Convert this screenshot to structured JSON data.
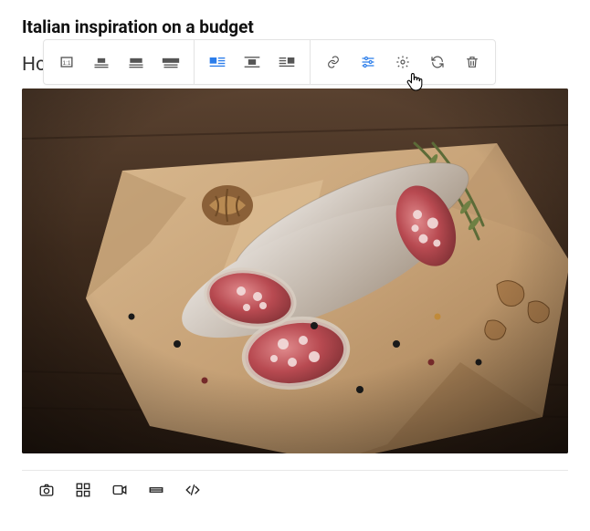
{
  "title": "Italian inspiration on a budget",
  "subtitle_partial": "Ho",
  "toolbar": {
    "groups": [
      {
        "items": [
          {
            "name": "size-original-icon",
            "active": false
          },
          {
            "name": "size-small-icon",
            "active": false
          },
          {
            "name": "size-medium-icon",
            "active": false
          },
          {
            "name": "size-wide-icon",
            "active": false
          }
        ]
      },
      {
        "items": [
          {
            "name": "align-left-icon",
            "active": true
          },
          {
            "name": "align-center-icon",
            "active": false
          },
          {
            "name": "align-right-icon",
            "active": false
          }
        ]
      },
      {
        "items": [
          {
            "name": "link-icon",
            "active": false
          },
          {
            "name": "edit-sliders-icon",
            "active": true
          },
          {
            "name": "settings-gear-icon",
            "active": false
          },
          {
            "name": "refresh-icon",
            "active": false
          },
          {
            "name": "trash-icon",
            "active": false
          }
        ]
      }
    ]
  },
  "bottom_bar": {
    "items": [
      {
        "name": "camera-icon"
      },
      {
        "name": "gallery-grid-icon"
      },
      {
        "name": "video-icon"
      },
      {
        "name": "divider-icon"
      },
      {
        "name": "code-icon"
      }
    ]
  }
}
